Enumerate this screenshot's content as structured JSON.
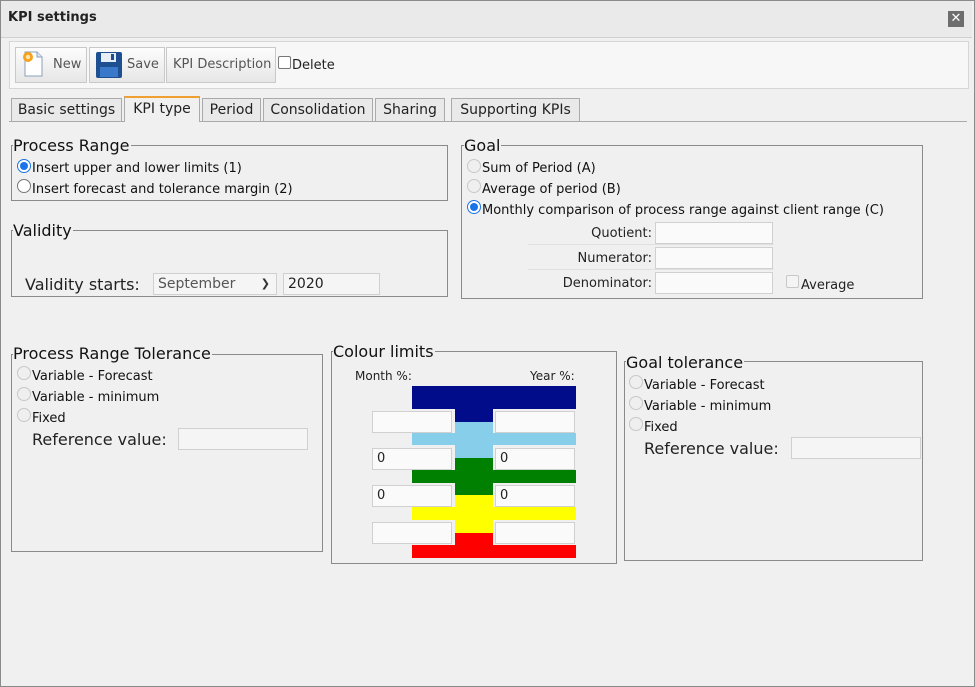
{
  "window": {
    "title": "KPI settings"
  },
  "toolbar": {
    "new_label": "New",
    "save_label": "Save",
    "kpi_description_label": "KPI Description",
    "delete_label": "Delete"
  },
  "tabs": [
    {
      "label": "Basic settings"
    },
    {
      "label": "KPI type"
    },
    {
      "label": "Period"
    },
    {
      "label": "Consolidation"
    },
    {
      "label": "Sharing"
    },
    {
      "label": "Supporting KPIs"
    }
  ],
  "process_range": {
    "title": "Process Range",
    "options": [
      {
        "label": "Insert upper and lower limits (1)"
      },
      {
        "label": "Insert forecast and tolerance margin (2)"
      }
    ]
  },
  "validity": {
    "title": "Validity",
    "starts_label": "Validity starts:",
    "month": "September",
    "year": "2020"
  },
  "goal": {
    "title": "Goal",
    "options": [
      {
        "label": "Sum of Period (A)"
      },
      {
        "label": "Average of period (B)"
      },
      {
        "label": "Monthly comparison of process range against client range (C)"
      }
    ],
    "quotient_label": "Quotient:",
    "numerator_label": "Numerator:",
    "denominator_label": "Denominator:",
    "average_label": "Average"
  },
  "process_range_tolerance": {
    "title": "Process Range Tolerance",
    "options": [
      {
        "label": "Variable - Forecast"
      },
      {
        "label": "Variable - minimum"
      },
      {
        "label": "Fixed"
      }
    ],
    "reference_label": "Reference value:"
  },
  "colour_limits": {
    "title": "Colour limits",
    "month_label": "Month %:",
    "year_label": "Year %:",
    "colors": [
      "#000c8a",
      "#87ceeb",
      "#008000",
      "#ffff00",
      "#ff0000"
    ],
    "month_values": [
      "",
      "0",
      "0",
      ""
    ],
    "year_values": [
      "",
      "0",
      "0",
      ""
    ]
  },
  "goal_tolerance": {
    "title": "Goal tolerance",
    "options": [
      {
        "label": "Variable - Forecast"
      },
      {
        "label": "Variable - minimum"
      },
      {
        "label": "Fixed"
      }
    ],
    "reference_label": "Reference value:"
  }
}
